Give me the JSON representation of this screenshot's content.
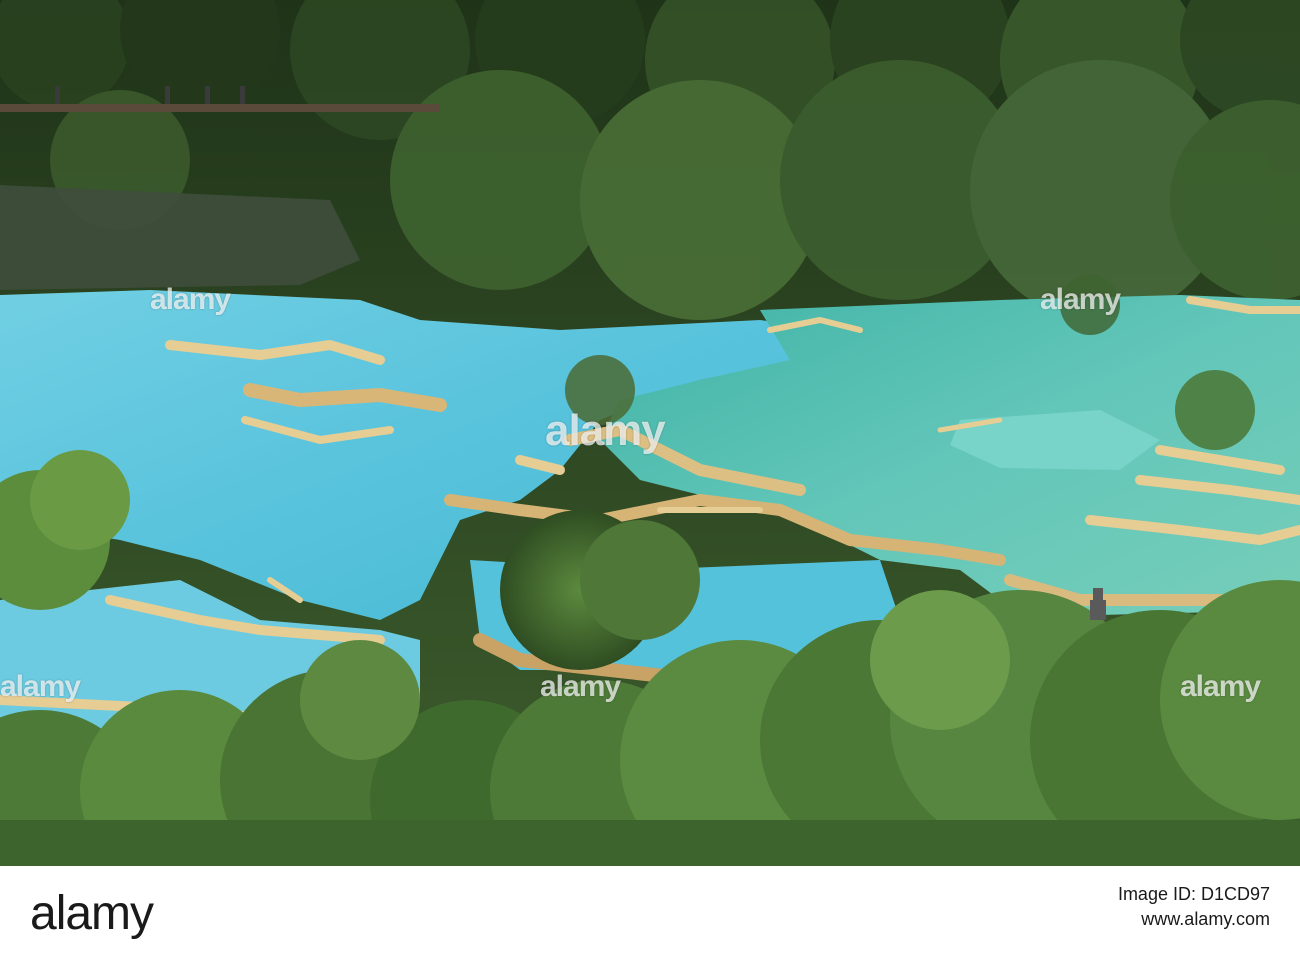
{
  "watermark": {
    "center": "alamy",
    "tl": "alamy",
    "tr": "alamy",
    "bl": "alamy",
    "br": "alamy",
    "bc": "alamy"
  },
  "footer": {
    "logo": "alamy",
    "image_id_label": "Image ID: D1CD97",
    "url": "www.alamy.com"
  },
  "colors": {
    "forest": "#35532a",
    "pool_blue": "#5fc4d8",
    "pool_teal": "#56c0b8",
    "travertine": "#e3c98f"
  }
}
